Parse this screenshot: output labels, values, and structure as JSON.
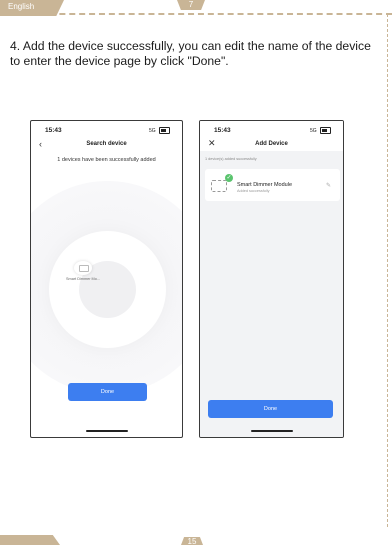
{
  "header": {
    "language": "English",
    "page_number": "7"
  },
  "instruction": "4. Add the device successfully, you can edit the name of the device to enter the device page by click \"Done\".",
  "screen1": {
    "time": "15:43",
    "signal": "5G",
    "title": "Search device",
    "back_icon": "chevron-left-icon",
    "success_message": "1 devices have been successfully added",
    "device_label": "Smart Dimmer Mo...",
    "done_label": "Done"
  },
  "screen2": {
    "time": "15:43",
    "signal": "5G",
    "title": "Add Device",
    "close_icon": "close-icon",
    "subtitle": "1 device(s) added successfully",
    "device_name": "Smart Dimmer Module",
    "device_status": "Added successfully",
    "done_label": "Done"
  },
  "footer": {
    "page_number": "15"
  },
  "colors": {
    "accent": "#c9b596",
    "button": "#3d7ef0",
    "success": "#5ac46e"
  }
}
